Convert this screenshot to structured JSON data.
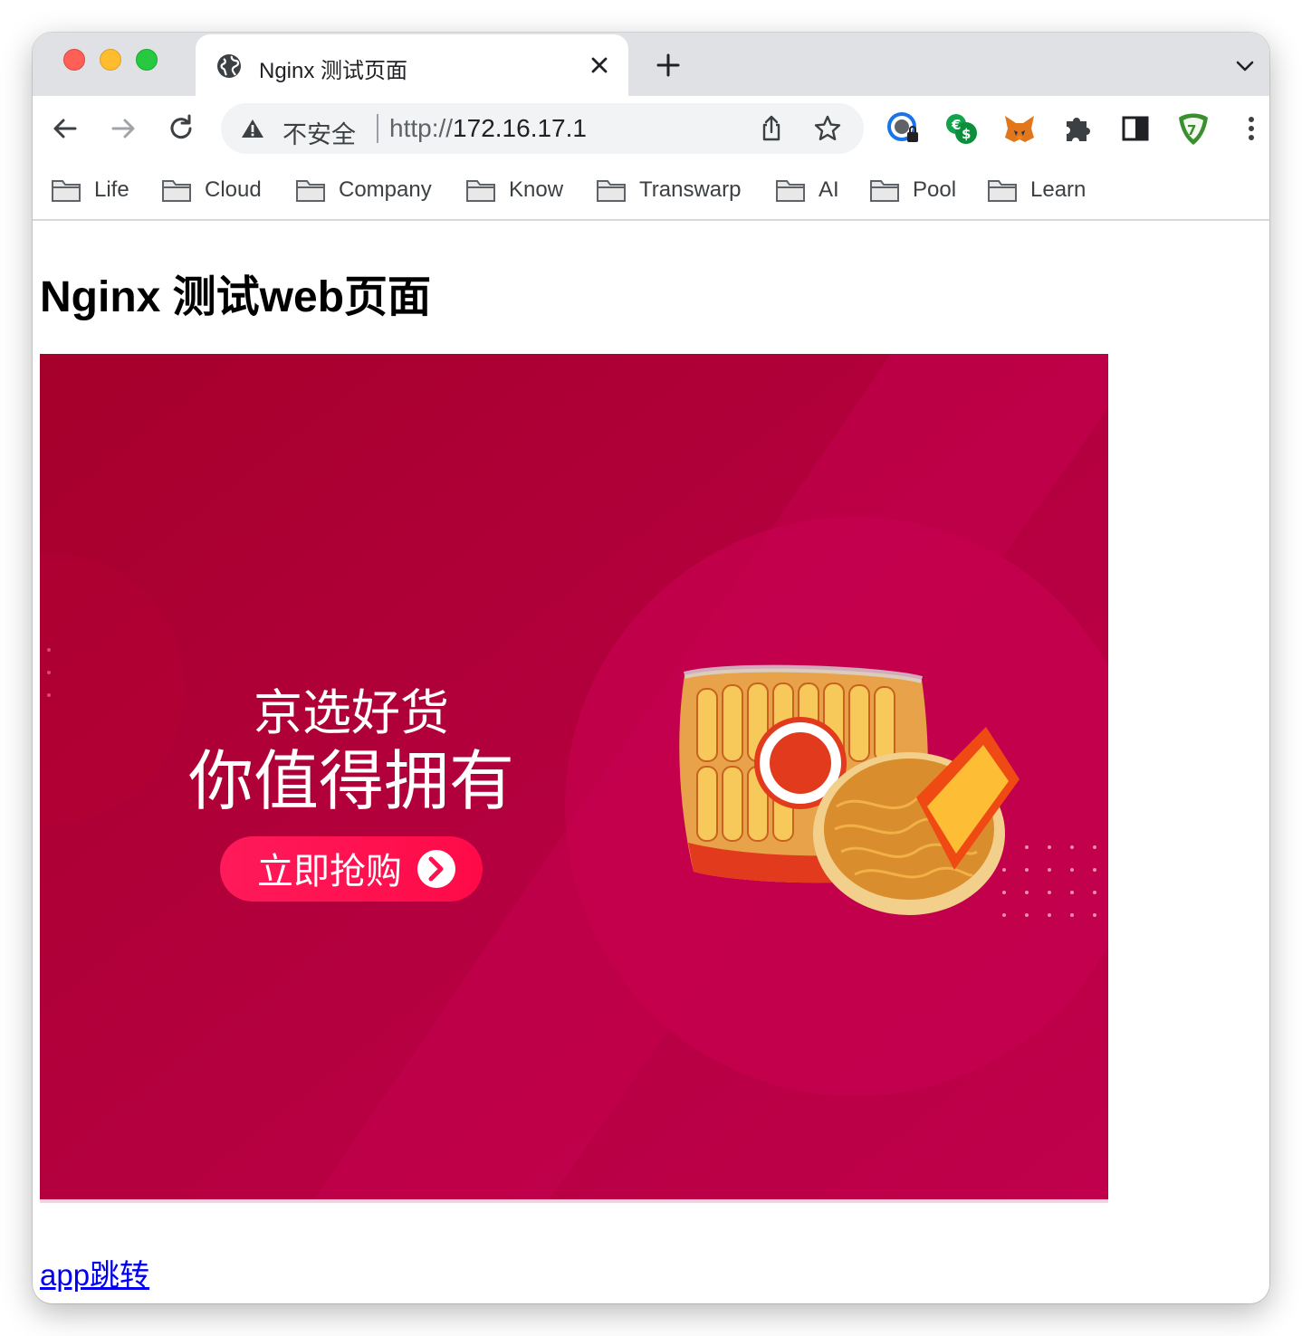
{
  "tab": {
    "title": "Nginx 测试页面",
    "icon": "globe-icon"
  },
  "address_bar": {
    "security_label": "不安全",
    "url_scheme": "http://",
    "url_host": "172.16.17.1"
  },
  "extensions": [
    {
      "name": "password-lock-extension-icon"
    },
    {
      "name": "currency-converter-extension-icon"
    },
    {
      "name": "metamask-fox-icon"
    },
    {
      "name": "puzzle-extensions-icon"
    },
    {
      "name": "side-panel-icon"
    },
    {
      "name": "vpn-shield-extension-icon"
    }
  ],
  "bookmarks": [
    {
      "label": "Life"
    },
    {
      "label": "Cloud"
    },
    {
      "label": "Company"
    },
    {
      "label": "Know"
    },
    {
      "label": "Transwarp"
    },
    {
      "label": "AI"
    },
    {
      "label": "Pool"
    },
    {
      "label": "Learn"
    }
  ],
  "page": {
    "heading": "Nginx 测试web页面",
    "banner": {
      "line1": "京选好货",
      "line2": "你值得拥有",
      "button_label": "立即抢购"
    },
    "link_text": "app跳转"
  },
  "colors": {
    "banner_dark": "#a8002c",
    "banner_light": "#c4004f",
    "button_red": "#ff1150",
    "link": "#0000ee"
  }
}
